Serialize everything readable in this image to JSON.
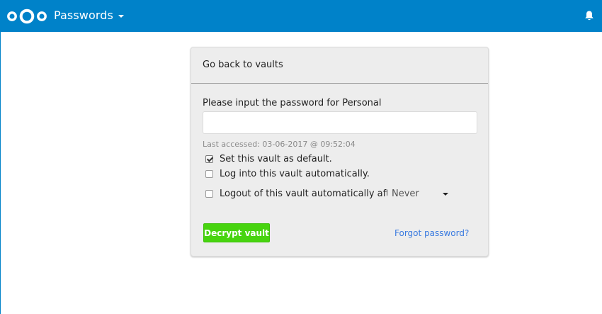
{
  "header": {
    "app_title": "Passwords",
    "brand_color": "#0082c9",
    "logo_icon": "nextcloud-logo-icon",
    "notification_icon": "bell-icon"
  },
  "vault_unlock": {
    "back_link": "Go back to vaults",
    "prompt": "Please input the password for Personal",
    "password_value": "",
    "last_accessed": "Last accessed: 03-06-2017 @ 09:52:04",
    "options": {
      "set_default": {
        "label": "Set this vault as default.",
        "checked": true
      },
      "auto_login": {
        "label": "Log into this vault automatically.",
        "checked": false
      },
      "auto_logout": {
        "label": "Logout of this vault automatically after:",
        "checked": false
      }
    },
    "logout_after_select": {
      "value": "Never"
    },
    "decrypt_button": "Decrypt vault",
    "decrypt_button_color": "#47d40f",
    "forgot_link": "Forgot password?",
    "link_color": "#3a7be0"
  }
}
